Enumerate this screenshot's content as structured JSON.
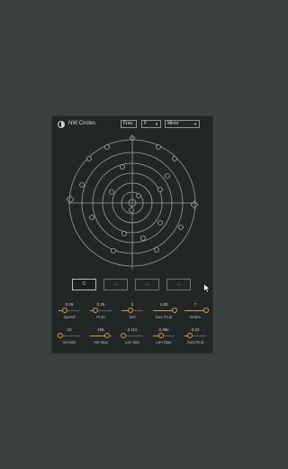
{
  "header": {
    "title": "NW Circles",
    "mode": "Free",
    "key": "F",
    "scale": "Minor"
  },
  "notes": {
    "buttons": [
      "C",
      "...",
      "...",
      "..."
    ]
  },
  "controls": [
    {
      "value": "0.29",
      "label": "Speed",
      "level": 0.29
    },
    {
      "value": "0.25",
      "label": "Prob",
      "level": 0.25
    },
    {
      "value": "3",
      "label": "Oct",
      "level": 0.4
    },
    {
      "value": "1.00",
      "label": "Sus Prob",
      "level": 1.0
    },
    {
      "value": "7",
      "label": "Notes",
      "level": 1.0
    },
    {
      "value": "10",
      "label": "Vel Min",
      "level": 0.1
    },
    {
      "value": "105",
      "label": "Vel Max",
      "level": 0.8
    },
    {
      "value": "0.11s",
      "label": "Len Min",
      "level": 0.1
    },
    {
      "value": "0.38s",
      "label": "Len Max",
      "level": 0.38
    },
    {
      "value": "0.23",
      "label": "Sust Rnd",
      "level": 0.23
    }
  ],
  "colors": {
    "accent": "#d89b3f",
    "panel": "#222626",
    "background": "#3b4140",
    "lines": "#9a9f9e"
  }
}
